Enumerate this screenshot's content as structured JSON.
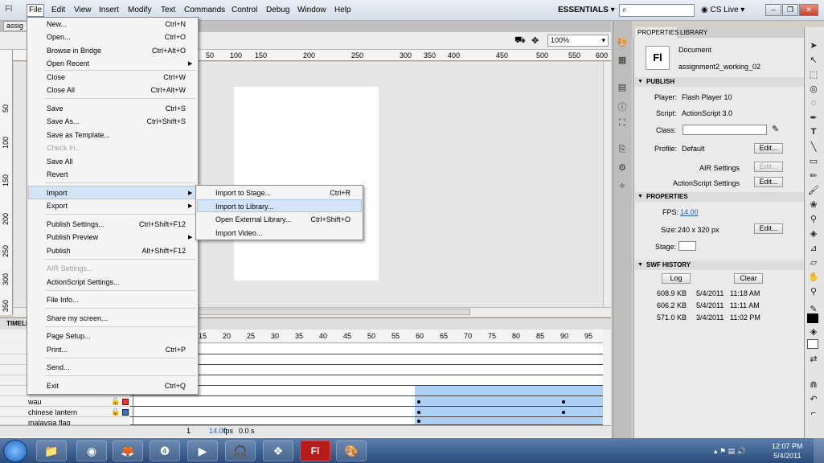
{
  "app": {
    "logo": "Fl",
    "workspace": "ESSENTIALS",
    "cslive": "CS Live"
  },
  "menubar": [
    "File",
    "Edit",
    "View",
    "Insert",
    "Modify",
    "Text",
    "Commands",
    "Control",
    "Debug",
    "Window",
    "Help"
  ],
  "doc_tab": "assig",
  "zoom": "100%",
  "ruler_top": [
    "50",
    "100",
    "150",
    "200",
    "250",
    "300",
    "350",
    "400",
    "450",
    "500",
    "550",
    "600"
  ],
  "ruler_left": [
    "50",
    "100",
    "150",
    "200",
    "250",
    "300",
    "350"
  ],
  "file_menu": [
    {
      "label": "New...",
      "shortcut": "Ctrl+N"
    },
    {
      "label": "Open...",
      "shortcut": "Ctrl+O"
    },
    {
      "label": "Browse in Bridge",
      "shortcut": "Ctrl+Alt+O"
    },
    {
      "label": "Open Recent",
      "shortcut": ""
    },
    {
      "label": "Close",
      "shortcut": "Ctrl+W"
    },
    {
      "label": "Close All",
      "shortcut": "Ctrl+Alt+W"
    },
    {
      "label": "Save",
      "shortcut": "Ctrl+S"
    },
    {
      "label": "Save As...",
      "shortcut": "Ctrl+Shift+S"
    },
    {
      "label": "Save as Template...",
      "shortcut": ""
    },
    {
      "label": "Check In...",
      "shortcut": ""
    },
    {
      "label": "Save All",
      "shortcut": ""
    },
    {
      "label": "Revert",
      "shortcut": ""
    },
    {
      "label": "Import",
      "shortcut": ""
    },
    {
      "label": "Export",
      "shortcut": ""
    },
    {
      "label": "Publish Settings...",
      "shortcut": "Ctrl+Shift+F12"
    },
    {
      "label": "Publish Preview",
      "shortcut": ""
    },
    {
      "label": "Publish",
      "shortcut": "Alt+Shift+F12"
    },
    {
      "label": "AIR Settings...",
      "shortcut": ""
    },
    {
      "label": "ActionScript Settings...",
      "shortcut": ""
    },
    {
      "label": "File Info...",
      "shortcut": ""
    },
    {
      "label": "Share my screen...",
      "shortcut": ""
    },
    {
      "label": "Page Setup...",
      "shortcut": ""
    },
    {
      "label": "Print...",
      "shortcut": "Ctrl+P"
    },
    {
      "label": "Send...",
      "shortcut": ""
    },
    {
      "label": "Exit",
      "shortcut": "Ctrl+Q"
    }
  ],
  "import_submenu": [
    {
      "label": "Import to Stage...",
      "shortcut": "Ctrl+R"
    },
    {
      "label": "Import to Library...",
      "shortcut": ""
    },
    {
      "label": "Open External Library...",
      "shortcut": "Ctrl+Shift+O"
    },
    {
      "label": "Import Video...",
      "shortcut": ""
    }
  ],
  "timeline": {
    "label": "TIMELI",
    "frame_numbers": [
      "15",
      "20",
      "25",
      "30",
      "35",
      "40",
      "45",
      "50",
      "55",
      "60",
      "65",
      "70",
      "75",
      "80",
      "85",
      "90",
      "95"
    ],
    "layers": [
      "wau",
      "chinese lantern",
      "malaysia flag"
    ],
    "footer_fps": "14.00",
    "footer_fps_unit": "fps",
    "footer_time": "0.0 s",
    "footer_frame": "1"
  },
  "properties": {
    "tab_props": "PROPERTIES",
    "tab_library": "LIBRARY",
    "doc_icon": "Fl",
    "doc_type": "Document",
    "doc_name": "assignment2_working_02",
    "publish_header": "PUBLISH",
    "player_label": "Player:",
    "player_value": "Flash Player 10",
    "script_label": "Script:",
    "script_value": "ActionScript 3.0",
    "class_label": "Class:",
    "profile_label": "Profile:",
    "profile_value": "Default",
    "edit": "Edit...",
    "air_settings": "AIR Settings",
    "as_settings": "ActionScript Settings",
    "props_header": "PROPERTIES",
    "fps_label": "FPS:",
    "fps_value": "14.00",
    "size_label": "Size:",
    "size_value": "240 x 320 px",
    "stage_label": "Stage:",
    "swf_header": "SWF HISTORY",
    "log": "Log",
    "clear": "Clear",
    "history": [
      {
        "size": "608.9 KB",
        "date": "5/4/2011",
        "time": "11:18 AM"
      },
      {
        "size": "606.2 KB",
        "date": "5/4/2011",
        "time": "11:11 AM"
      },
      {
        "size": "571.0 KB",
        "date": "3/4/2011",
        "time": "11:02 PM"
      }
    ]
  },
  "taskbar": {
    "time": "12:07 PM",
    "date": "5/4/2011",
    "flash_label": "Fl"
  }
}
